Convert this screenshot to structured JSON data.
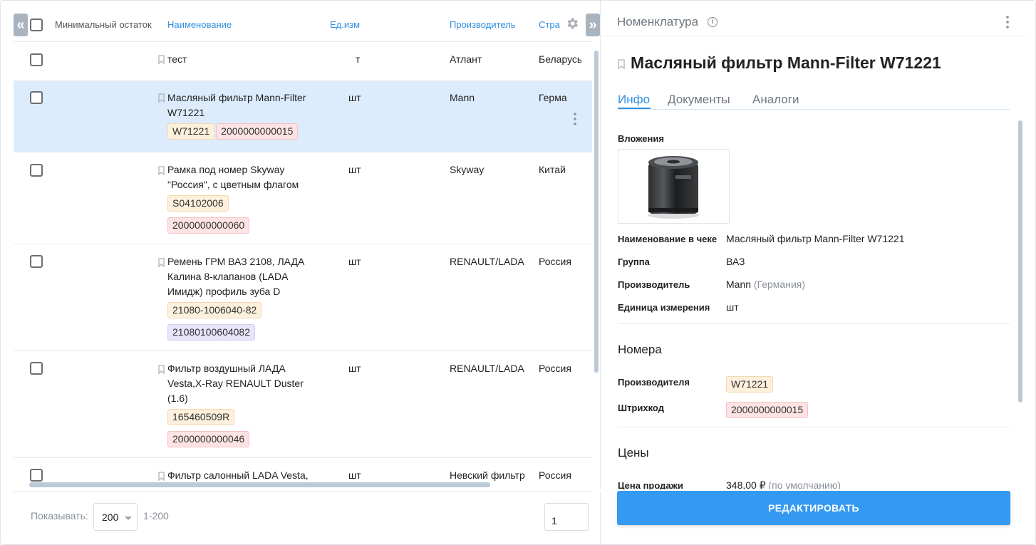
{
  "table": {
    "headers": {
      "min_stock": "Минимальный остаток",
      "name": "Наименование",
      "unit": "Ед.изм",
      "manufacturer": "Производитель",
      "country": "Стра"
    },
    "rows": [
      {
        "name": "тест",
        "unit": "т",
        "manufacturer": "Атлант",
        "country": "Беларусь",
        "tags": []
      },
      {
        "name": "Масляный фильтр Mann-Filter W71221",
        "unit": "шт",
        "manufacturer": "Mann",
        "country": "Герма",
        "tags": [
          {
            "text": "W71221",
            "kind": "orange"
          },
          {
            "text": "2000000000015",
            "kind": "pink"
          }
        ]
      },
      {
        "name": "Рамка под номер Skyway \"Россия\", с цветным флагом",
        "unit": "шт",
        "manufacturer": "Skyway",
        "country": "Китай",
        "tags": [
          {
            "text": "S04102006",
            "kind": "orange"
          },
          {
            "text": "2000000000060",
            "kind": "pink"
          }
        ]
      },
      {
        "name": "Ремень ГРМ ВАЗ 2108, ЛАДА Калина 8-клапанов (LADA Имидж) профиль зуба D",
        "unit": "шт",
        "manufacturer": "RENAULT/LADA",
        "country": "Россия",
        "tags": [
          {
            "text": "21080-1006040-82",
            "kind": "orange"
          },
          {
            "text": "21080100604082",
            "kind": "purple"
          }
        ]
      },
      {
        "name": "Фильтр воздушный ЛАДА Vesta,X-Ray RENAULT Duster (1.6)",
        "unit": "шт",
        "manufacturer": "RENAULT/LADA",
        "country": "Россия",
        "tags": [
          {
            "text": "165460509R",
            "kind": "orange"
          },
          {
            "text": "2000000000046",
            "kind": "pink"
          }
        ]
      },
      {
        "name": "Фильтр салонный LADA Vesta,",
        "unit": "шт",
        "manufacturer": "Невский фильтр",
        "country": "Россия",
        "tags": []
      }
    ]
  },
  "footer": {
    "show_label": "Показывать:",
    "page_size": "200",
    "range": "1-200",
    "page": "1"
  },
  "details": {
    "panel_title": "Номенклатура",
    "info_glyph": "i",
    "product_title": "Масляный фильтр Mann-Filter W71221",
    "tabs": [
      "Инфо",
      "Документы",
      "Аналоги"
    ],
    "attachments_label": "Вложения",
    "fields": [
      {
        "label": "Наименование в чеке",
        "value": "Масляный фильтр Mann-Filter W71221",
        "extra": ""
      },
      {
        "label": "Группа",
        "value": "ВАЗ",
        "extra": ""
      },
      {
        "label": "Производитель",
        "value": "Mann",
        "extra": "(Германия)"
      },
      {
        "label": "Единица измерения",
        "value": "шт",
        "extra": ""
      }
    ],
    "numbers": {
      "title": "Номера",
      "manufacturer_label": "Производителя",
      "manufacturer_value": "W71221",
      "barcode_label": "Штрихкод",
      "barcode_value": "2000000000015"
    },
    "prices": {
      "title": "Цены",
      "sale_label": "Цена продажи",
      "sale_value": "348,00 ₽",
      "sale_note": "(по умолчанию)"
    },
    "edit_button": "РЕДАКТИРОВАТЬ"
  },
  "icons": {
    "collapse": "«",
    "expand": "»"
  },
  "colors": {
    "accent": "#2f8fe0",
    "selected_row": "#dcecfd",
    "button": "#3499f0",
    "tag_orange": "#fdf0dc",
    "tag_pink": "#fde3e3",
    "tag_purple": "#e8e4fa"
  }
}
